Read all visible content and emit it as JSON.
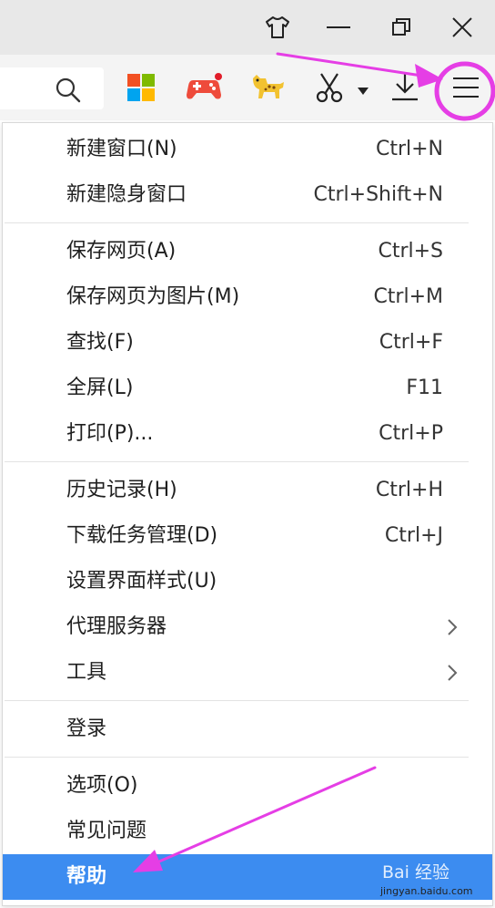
{
  "window_controls": {
    "skin_icon": "tshirt-icon",
    "minimize_icon": "minimize-icon",
    "restore_icon": "restore-icon",
    "close_icon": "close-icon"
  },
  "toolbar": {
    "search_icon": "search-icon",
    "apps_icon": "apps-grid-icon",
    "game_icon": "gamepad-icon",
    "pet_icon": "leopard-icon",
    "screenshot_icon": "scissors-icon",
    "download_icon": "download-icon",
    "menu_icon": "hamburger-menu-icon"
  },
  "menu": {
    "groups": [
      [
        {
          "label": "新建窗口(N)",
          "shortcut": "Ctrl+N"
        },
        {
          "label": "新建隐身窗口",
          "shortcut": "Ctrl+Shift+N"
        }
      ],
      [
        {
          "label": "保存网页(A)",
          "shortcut": "Ctrl+S"
        },
        {
          "label": "保存网页为图片(M)",
          "shortcut": "Ctrl+M"
        },
        {
          "label": "查找(F)",
          "shortcut": "Ctrl+F"
        },
        {
          "label": "全屏(L)",
          "shortcut": "F11"
        },
        {
          "label": "打印(P)...",
          "shortcut": "Ctrl+P"
        }
      ],
      [
        {
          "label": "历史记录(H)",
          "shortcut": "Ctrl+H"
        },
        {
          "label": "下载任务管理(D)",
          "shortcut": "Ctrl+J"
        },
        {
          "label": "设置界面样式(U)",
          "shortcut": ""
        },
        {
          "label": "代理服务器",
          "shortcut": "",
          "submenu": true
        },
        {
          "label": "工具",
          "shortcut": "",
          "submenu": true
        }
      ],
      [
        {
          "label": "登录",
          "shortcut": ""
        }
      ],
      [
        {
          "label": "选项(O)",
          "shortcut": ""
        },
        {
          "label": "常见问题",
          "shortcut": ""
        },
        {
          "label": "帮助",
          "shortcut": "",
          "active": true
        }
      ]
    ]
  },
  "colors": {
    "highlight": "#3c8cf0",
    "annotation": "#e53ee5"
  },
  "watermark": {
    "top": "Bai 经验",
    "bottom": "jingyan.baidu.com"
  }
}
